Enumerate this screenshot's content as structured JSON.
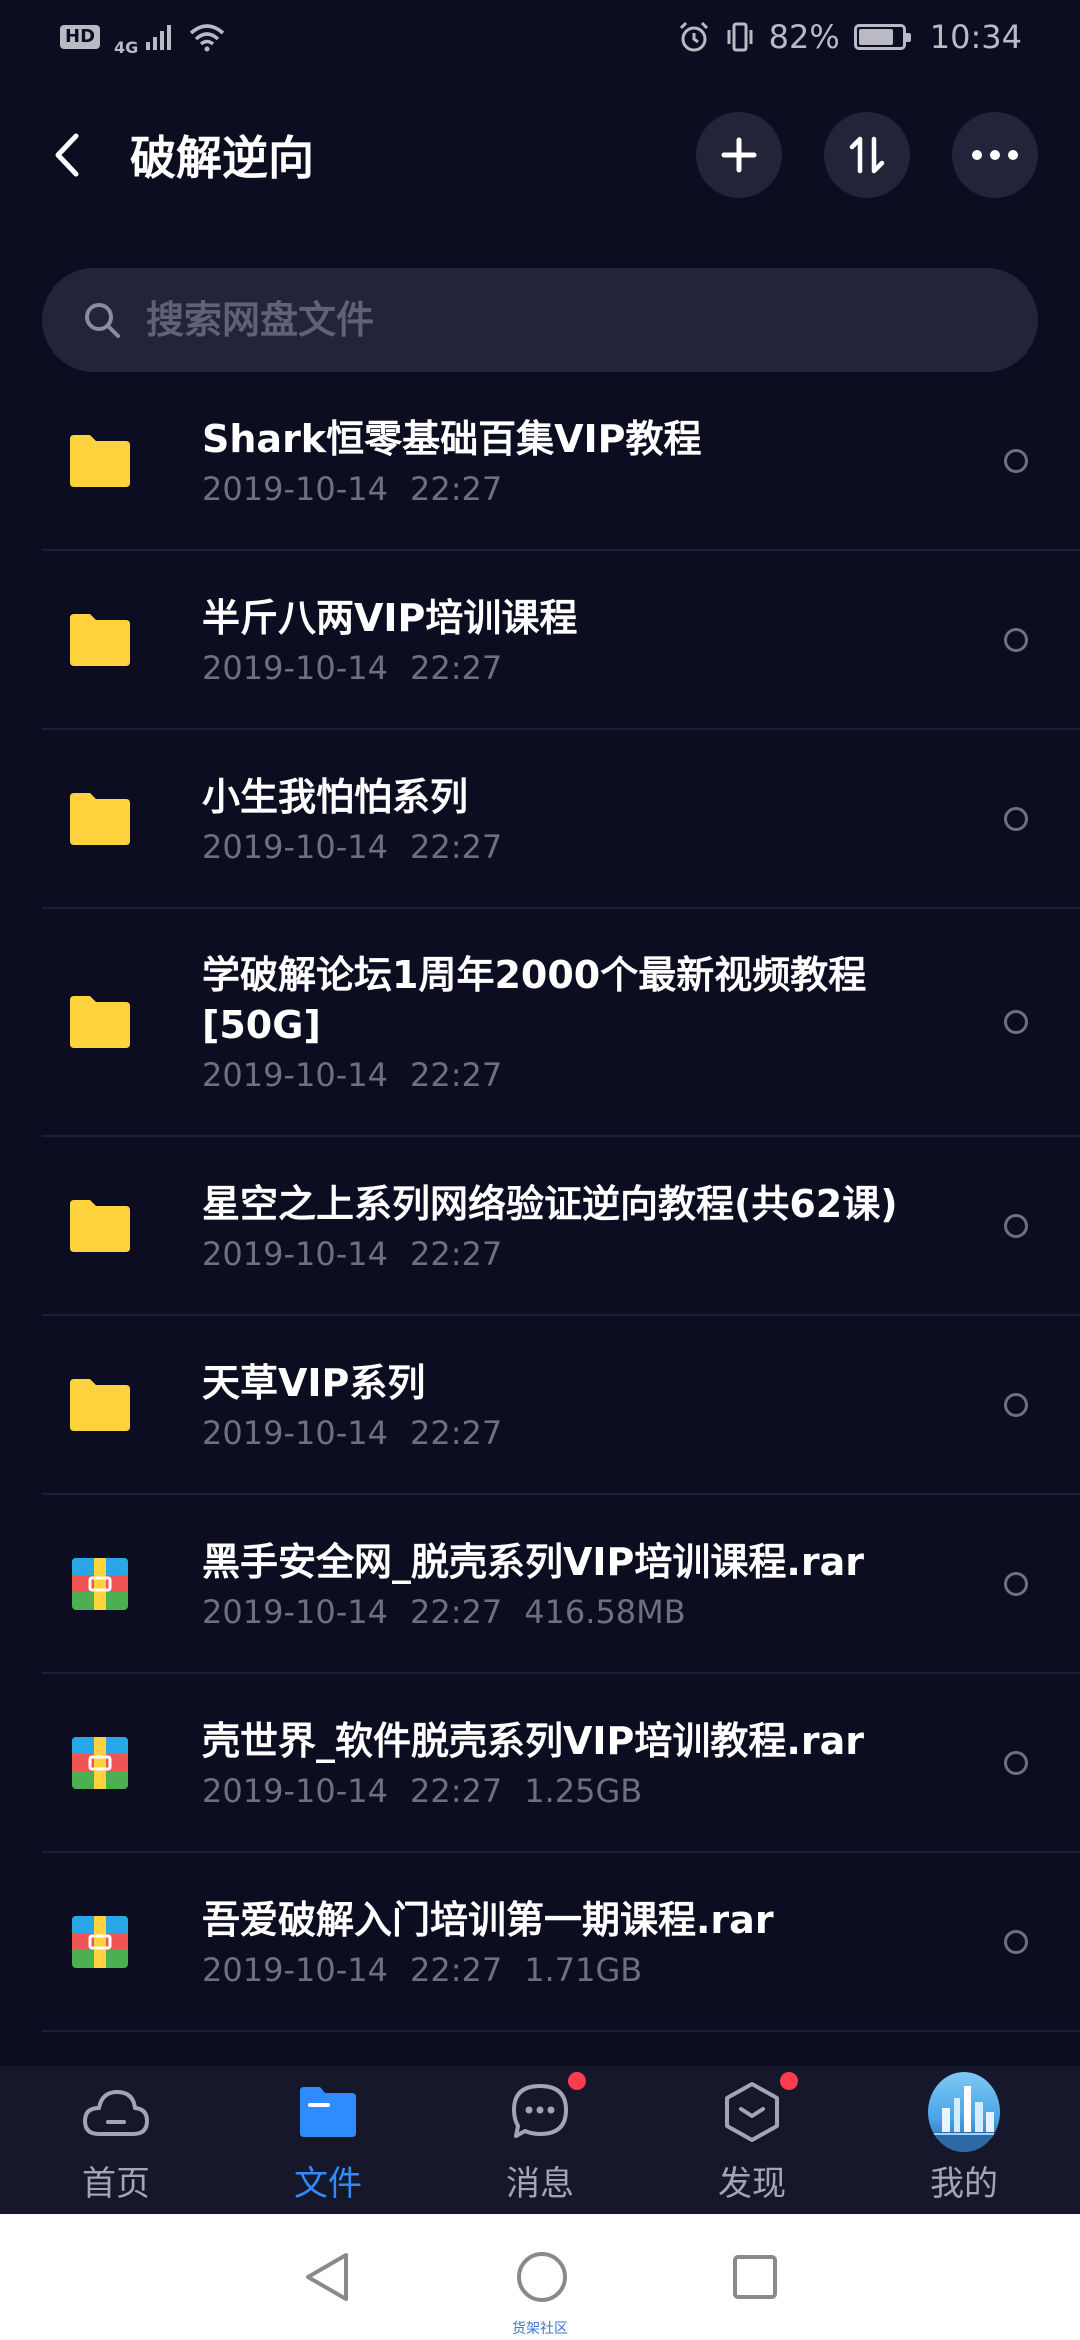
{
  "status_bar": {
    "hd_label": "HD",
    "network_label": "4G",
    "battery_percent": 82,
    "battery_text": "82%",
    "time": "10:34"
  },
  "header": {
    "title": "破解逆向",
    "icons": [
      "back-chevron-icon",
      "plus-icon",
      "sort-icon",
      "more-icon"
    ]
  },
  "search": {
    "placeholder": "搜索网盘文件"
  },
  "files": [
    {
      "name": "Shark恒零基础百集VIP教程",
      "date": "2019-10-14",
      "time": "22:27",
      "size": "",
      "type": "folder"
    },
    {
      "name": "半斤八两VIP培训课程",
      "date": "2019-10-14",
      "time": "22:27",
      "size": "",
      "type": "folder"
    },
    {
      "name": "小生我怕怕系列",
      "date": "2019-10-14",
      "time": "22:27",
      "size": "",
      "type": "folder"
    },
    {
      "name": "学破解论坛1周年2000个最新视频教程[50G]",
      "date": "2019-10-14",
      "time": "22:27",
      "size": "",
      "type": "folder"
    },
    {
      "name": "星空之上系列网络验证逆向教程(共62课)",
      "date": "2019-10-14",
      "time": "22:27",
      "size": "",
      "type": "folder"
    },
    {
      "name": "天草VIP系列",
      "date": "2019-10-14",
      "time": "22:27",
      "size": "",
      "type": "folder"
    },
    {
      "name": "黑手安全网_脱壳系列VIP培训课程.rar",
      "date": "2019-10-14",
      "time": "22:27",
      "size": "416.58MB",
      "type": "rar"
    },
    {
      "name": "壳世界_软件脱壳系列VIP培训教程.rar",
      "date": "2019-10-14",
      "time": "22:27",
      "size": "1.25GB",
      "type": "rar"
    },
    {
      "name": "吾爱破解入门培训第一期课程.rar",
      "date": "2019-10-14",
      "time": "22:27",
      "size": "1.71GB",
      "type": "rar"
    }
  ],
  "bottom_nav": [
    {
      "label": "首页",
      "icon": "cloud-home-icon",
      "active": false,
      "badge": false
    },
    {
      "label": "文件",
      "icon": "folder-icon",
      "active": true,
      "badge": false
    },
    {
      "label": "消息",
      "icon": "chat-icon",
      "active": false,
      "badge": true
    },
    {
      "label": "发现",
      "icon": "discover-box-icon",
      "active": false,
      "badge": true
    },
    {
      "label": "我的",
      "icon": "avatar",
      "active": false,
      "badge": false
    }
  ],
  "system_nav": {
    "icons": [
      "back-triangle-icon",
      "home-circle-icon",
      "recents-square-icon"
    ],
    "watermark": "货架社区"
  },
  "colors": {
    "background": "#0c0d21",
    "surface": "#23243a",
    "accent": "#2f8cff",
    "folder": "#ffd33d",
    "badge": "#ff3b4e",
    "muted_text": "#6d6f82"
  }
}
